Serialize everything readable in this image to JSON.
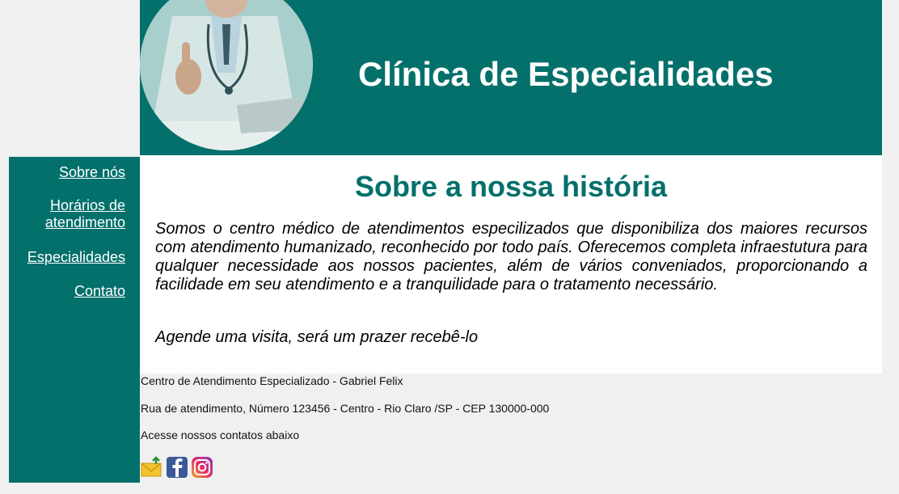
{
  "header": {
    "title": "Clínica de Especialidades",
    "photo_alt": "doctor-photo"
  },
  "sidebar": {
    "items": [
      {
        "label": "Sobre nós"
      },
      {
        "label": "Horários de atendimento"
      },
      {
        "label": "Especialidades"
      },
      {
        "label": "Contato"
      }
    ]
  },
  "main": {
    "title": "Sobre a nossa história",
    "paragraph": "Somos o centro médico de atendimentos especilizados que disponibiliza dos maiores recursos com atendimento humanizado, reconhecido por todo país. Oferecemos completa infraestutura para qualquer necessidade aos nossos pacientes, além de vários conveniados, proporcionando a facilidade em seu atendimento e a tranquilidade para o tratamento necessário.",
    "cta": "Agende uma visita, será um prazer recebê-lo"
  },
  "footer": {
    "line1": "Centro de Atendimento Especializado - Gabriel Felix",
    "line2": "Rua de atendimento, Número 123456 - Centro - Rio Claro /SP - CEP 130000-000",
    "line3": "Acesse nossos contatos abaixo",
    "icons": [
      "email-icon",
      "facebook-icon",
      "instagram-icon"
    ]
  },
  "colors": {
    "brand": "#04706b",
    "background": "#f0f0f0",
    "content_bg": "#ffffff"
  }
}
